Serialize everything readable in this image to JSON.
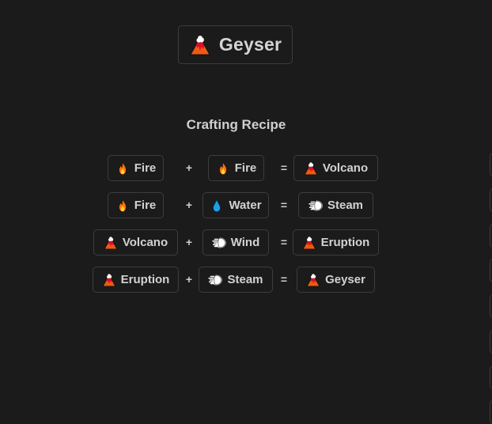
{
  "result": {
    "icon": "volcano-icon",
    "label": "Geyser"
  },
  "heading": "Crafting Recipe",
  "recipes": [
    {
      "a": {
        "icon": "fire-icon",
        "label": "Fire"
      },
      "plus": "+",
      "b": {
        "icon": "fire-icon",
        "label": "Fire"
      },
      "equals": "=",
      "out": {
        "icon": "volcano-icon",
        "label": "Volcano"
      }
    },
    {
      "a": {
        "icon": "fire-icon",
        "label": "Fire"
      },
      "plus": "+",
      "b": {
        "icon": "water-drop-icon",
        "label": "Water"
      },
      "equals": "=",
      "out": {
        "icon": "wind-icon",
        "label": "Steam"
      }
    },
    {
      "a": {
        "icon": "volcano-icon",
        "label": "Volcano"
      },
      "plus": "+",
      "b": {
        "icon": "wind-icon",
        "label": "Wind"
      },
      "equals": "=",
      "out": {
        "icon": "volcano-icon",
        "label": "Eruption"
      }
    },
    {
      "a": {
        "icon": "volcano-icon",
        "label": "Eruption"
      },
      "plus": "+",
      "b": {
        "icon": "wind-icon",
        "label": "Steam"
      },
      "equals": "=",
      "out": {
        "icon": "volcano-icon",
        "label": "Geyser"
      }
    }
  ],
  "colors": {
    "background": "#1b1b1b",
    "border": "#3d3d3d",
    "text": "#d2d2d2"
  }
}
